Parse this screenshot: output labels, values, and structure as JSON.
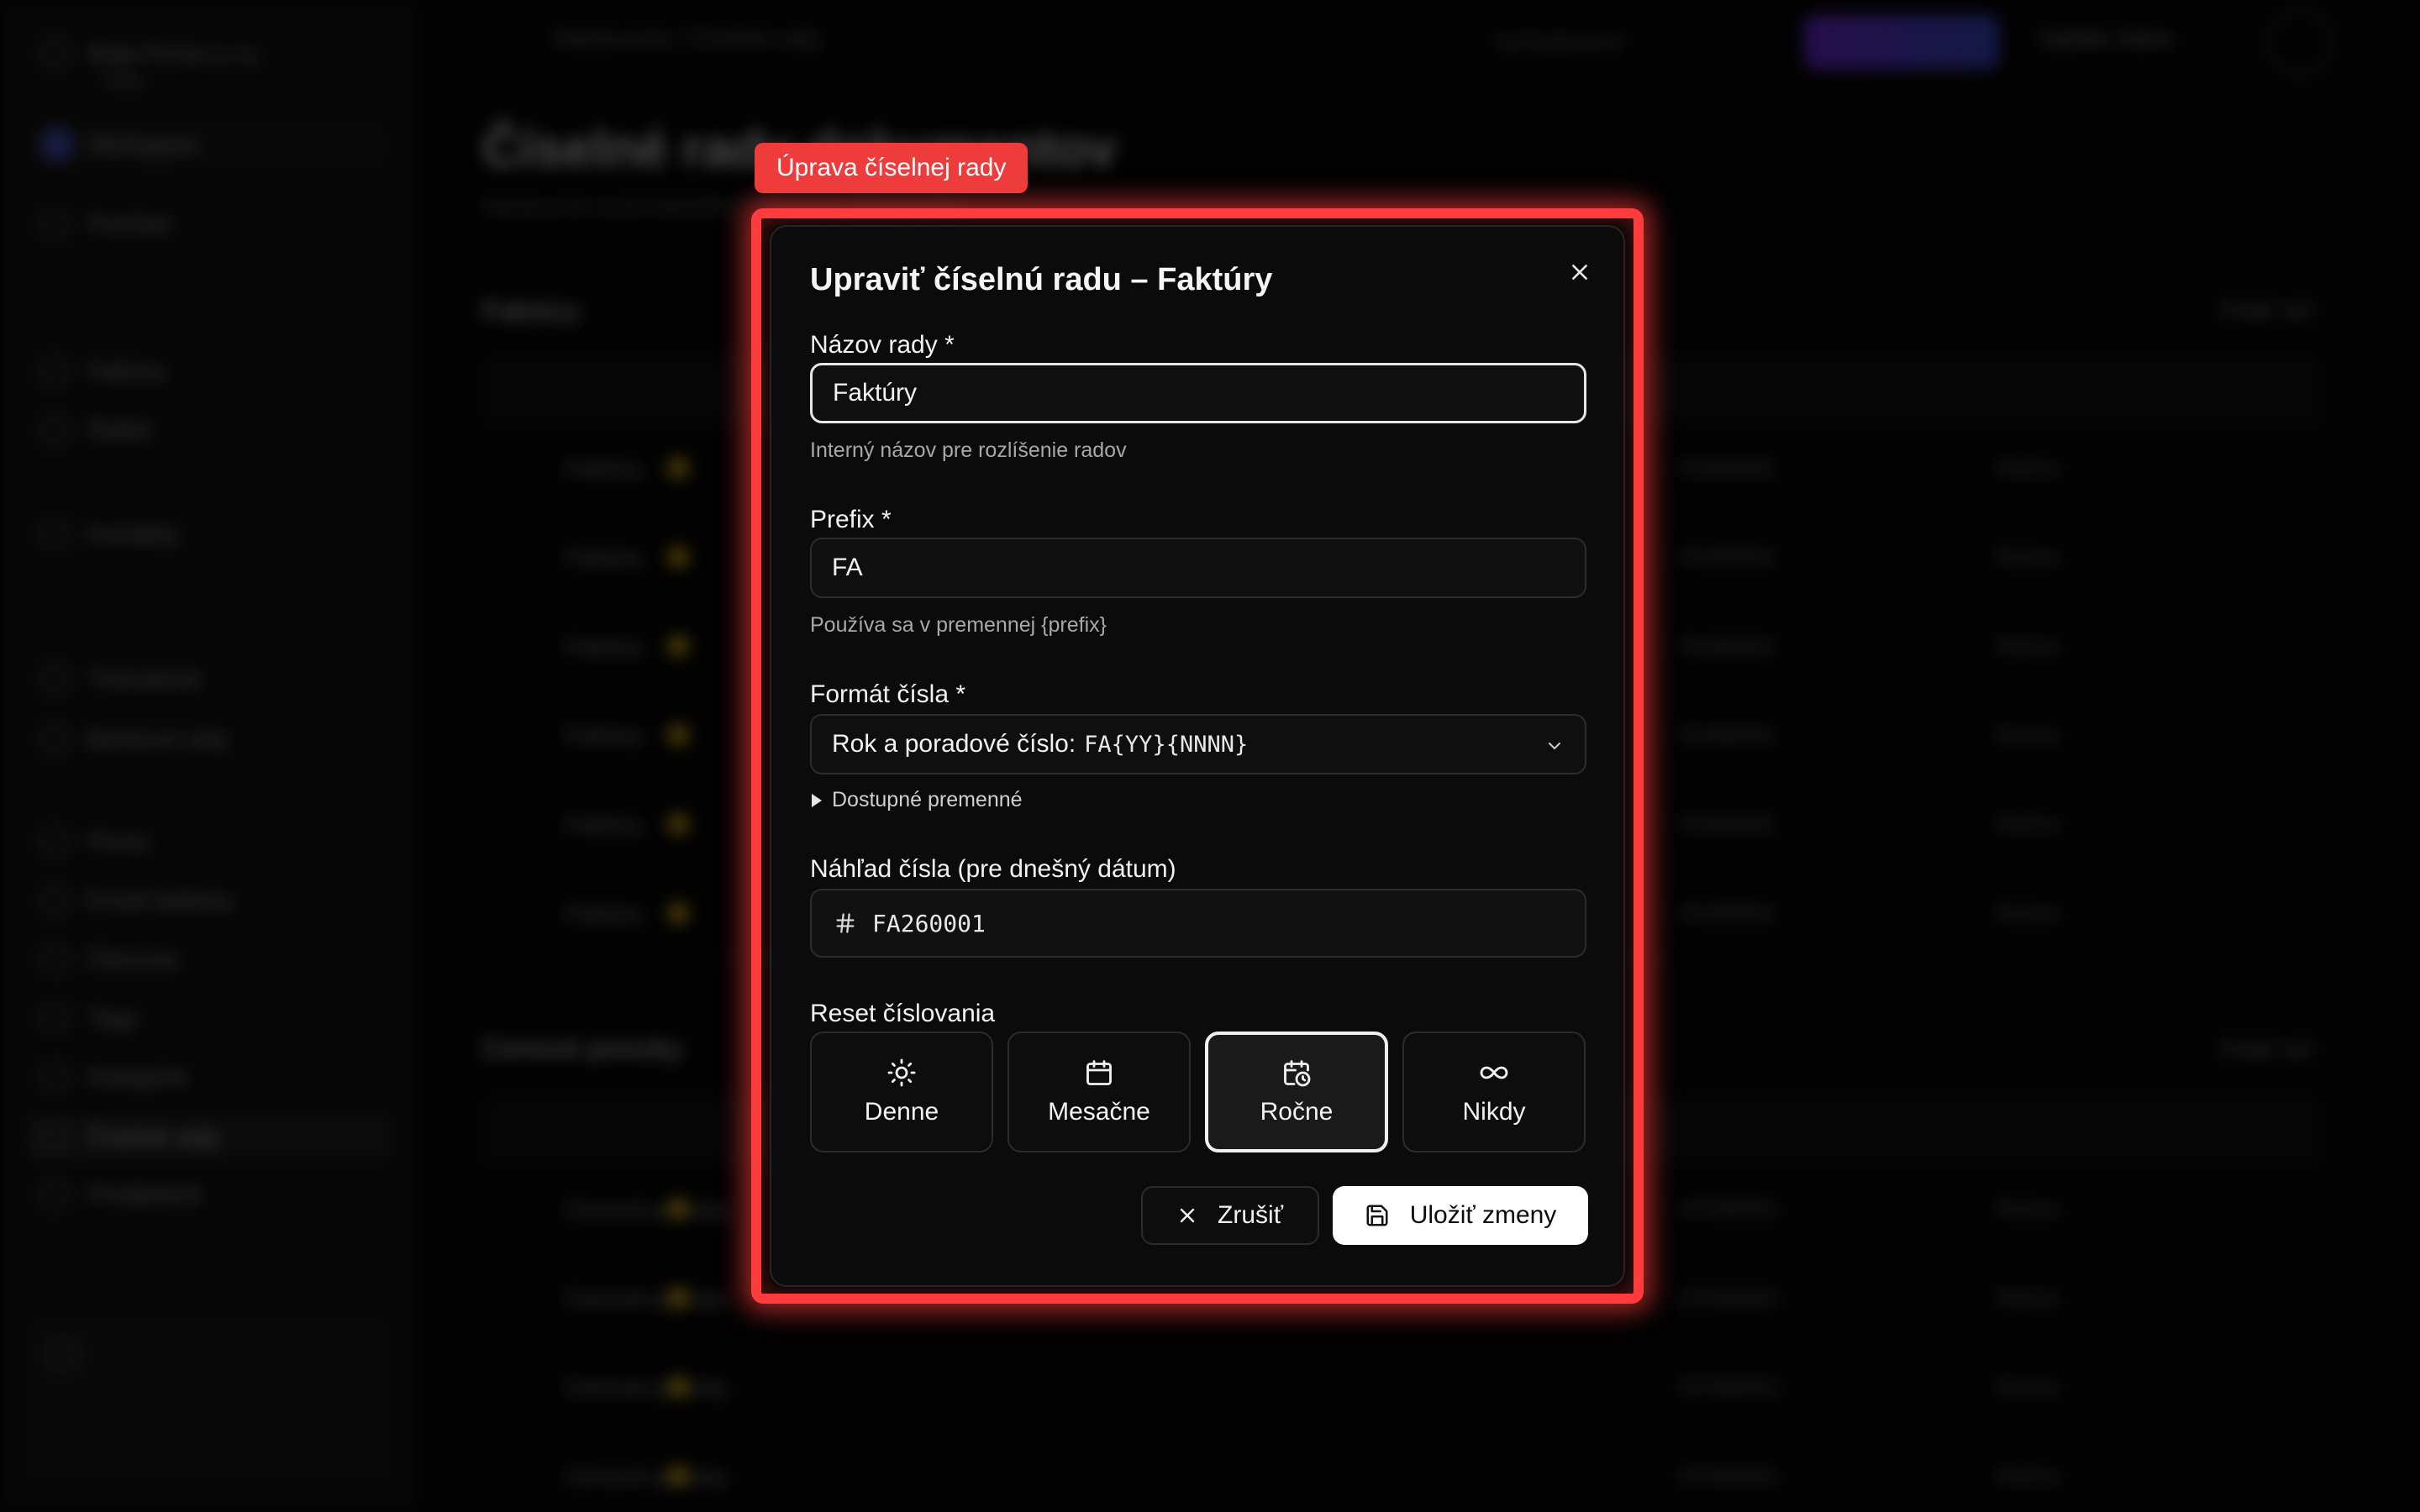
{
  "background": {
    "org_name": "Moja Firma s.r.o.",
    "org_sub": "Titok",
    "workspace": "Workspace",
    "sidebar_items": [
      "Prehľad",
      "Faktúry",
      "Ďalšie",
      "Kontakty",
      "Transakcie",
      "Bankové účty",
      "Firma",
      "Email šablóny",
      "Členovia",
      "Tagy",
      "Kategórie",
      "Číselné rady",
      "Predplatné"
    ],
    "breadcrumb": "Nastavenia  /  Číselné rady",
    "search_placeholder": "Vyhľadávanie",
    "update_label": "Update status",
    "page_title": "Číselné rady dokumentov",
    "page_subtitle": "Nastavenie automatického číslovania dokumentov",
    "section1": "Faktúry",
    "section2": "Cenové ponuky",
    "add_label": "Pridať rad",
    "rows1": [
      {
        "name": "Faktúry",
        "preview": "FA260001",
        "reset": "Ročne"
      },
      {
        "name": "Faktúry",
        "preview": "FA260001",
        "reset": "Ročne"
      },
      {
        "name": "Faktúry",
        "preview": "FA260001",
        "reset": "Ročne"
      },
      {
        "name": "Faktúry",
        "preview": "FA260001",
        "reset": "Ročne"
      },
      {
        "name": "Faktúry",
        "preview": "FA260001",
        "reset": "Ročne"
      },
      {
        "name": "Faktúry",
        "preview": "FA260001",
        "reset": "Ročne"
      }
    ],
    "rows2": [
      {
        "name": "Cenové ponuky",
        "preview": "CP260001",
        "reset": "Ročne"
      },
      {
        "name": "Cenové ponuky",
        "preview": "CP260001",
        "reset": "Ročne"
      },
      {
        "name": "Cenové ponuky",
        "preview": "CP260001",
        "reset": "Ročne"
      },
      {
        "name": "Cenové ponuky",
        "preview": "CP260001",
        "reset": "Ročne"
      }
    ]
  },
  "highlight_label": "Úprava číselnej rady",
  "modal": {
    "title": "Upraviť číselnú radu – Faktúry",
    "name_field": {
      "label": "Názov rady *",
      "value": "Faktúry",
      "help": "Interný názov pre rozlíšenie radov"
    },
    "prefix_field": {
      "label": "Prefix *",
      "value": "FA",
      "help": "Používa sa v premennej {prefix}"
    },
    "format_field": {
      "label": "Formát čísla *",
      "selected_text": "Rok a poradové číslo:",
      "selected_code": "FA{YY}{NNNN}"
    },
    "variables_toggle": "Dostupné premenné",
    "preview": {
      "label": "Náhľad čísla (pre dnešný dátum)",
      "value": "FA260001"
    },
    "reset": {
      "label": "Reset číslovania",
      "options": [
        {
          "label": "Denne",
          "icon": "sun-icon"
        },
        {
          "label": "Mesačne",
          "icon": "calendar-icon"
        },
        {
          "label": "Ročne",
          "icon": "calendar-clock-icon"
        },
        {
          "label": "Nikdy",
          "icon": "infinity-icon"
        }
      ],
      "selected": "Ročne"
    },
    "cancel_label": "Zrušiť",
    "save_label": "Uložiť zmeny"
  },
  "colors": {
    "highlight": "#ff3b3b",
    "modal_bg": "#0b0b0b",
    "save_bg": "#ffffff"
  }
}
